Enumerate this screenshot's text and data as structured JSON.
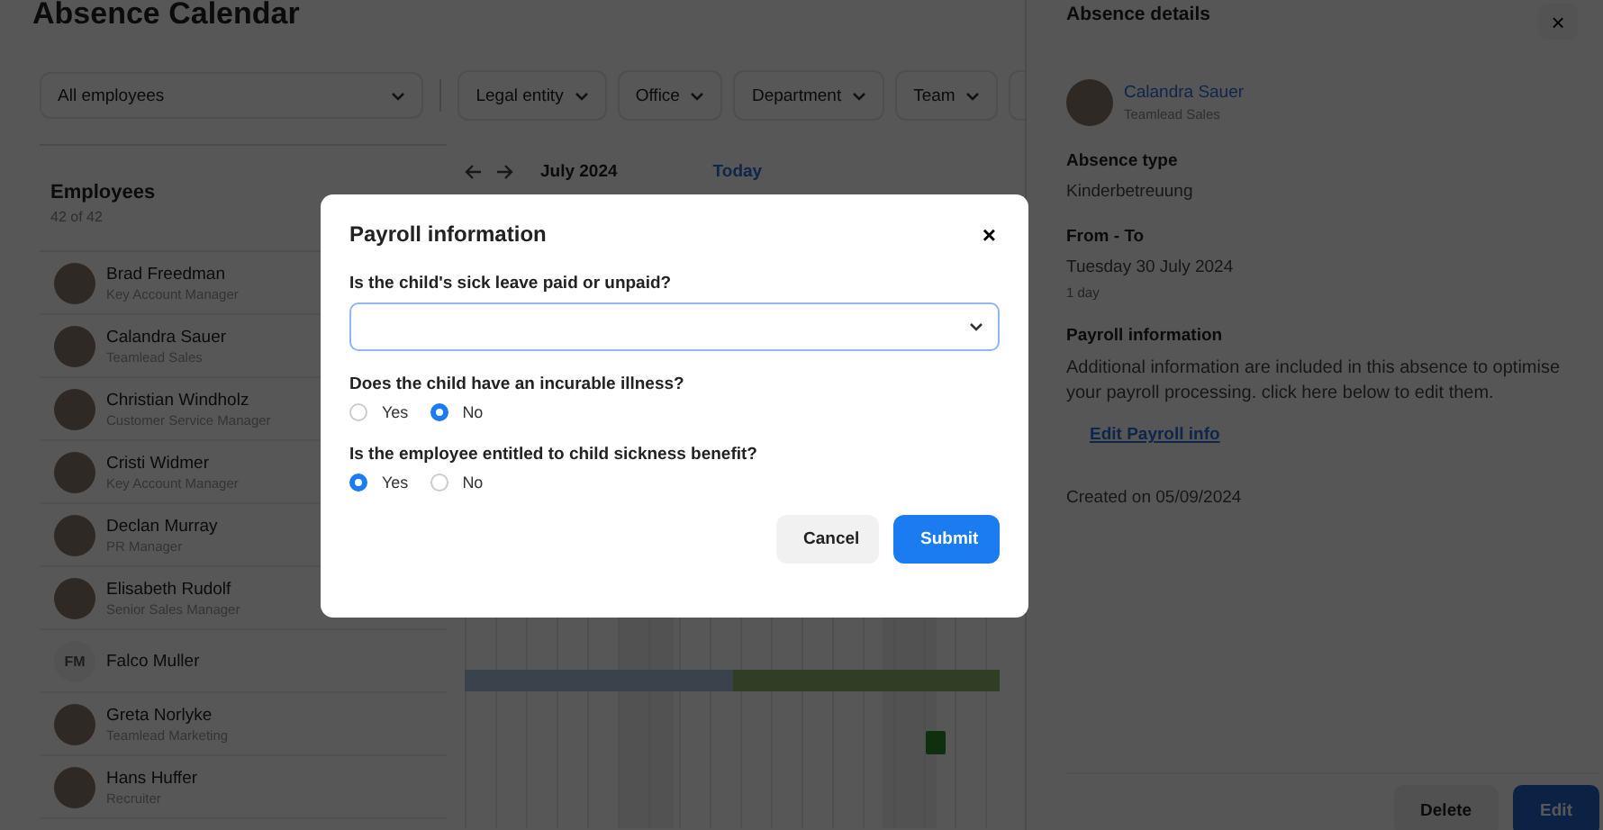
{
  "page_title": "Absence Calendar",
  "filters": {
    "employee_select": "All employees",
    "dropdowns": [
      "Legal entity",
      "Office",
      "Department",
      "Team"
    ]
  },
  "employees": {
    "title": "Employees",
    "count": "42 of 42",
    "items": [
      {
        "name": "Brad Freedman",
        "role": "Key Account Manager"
      },
      {
        "name": "Calandra Sauer",
        "role": "Teamlead Sales"
      },
      {
        "name": "Christian Windholz",
        "role": "Customer Service Manager"
      },
      {
        "name": "Cristi Widmer",
        "role": "Key Account Manager"
      },
      {
        "name": "Declan Murray",
        "role": "PR Manager"
      },
      {
        "name": "Elisabeth Rudolf",
        "role": "Senior Sales Manager"
      },
      {
        "name": "Falco Muller",
        "initials": "FM"
      },
      {
        "name": "Greta Norlyke",
        "role": "Teamlead Marketing"
      },
      {
        "name": "Hans Huffer",
        "role": "Recruiter"
      }
    ]
  },
  "calendar": {
    "month": "July 2024",
    "today": "Today"
  },
  "details": {
    "title": "Absence details",
    "close": "×",
    "person": {
      "name": "Calandra Sauer",
      "role": "Teamlead Sales"
    },
    "sections": [
      {
        "heading": "Absence type",
        "lines": [
          "Kinderbetreuung"
        ]
      },
      {
        "heading": "From - To",
        "lines": [
          "Tuesday 30 July 2024"
        ],
        "note": "1 day"
      },
      {
        "heading": "Payroll information",
        "text": "Additional information are included in this absence to optimise your payroll processing. click here below to edit them.",
        "link": "Edit Payroll info"
      }
    ],
    "created": "Created on 05/09/2024",
    "buttons": {
      "delete": "Delete",
      "edit": "Edit"
    }
  },
  "dialog": {
    "title": "Payroll information",
    "close": "×",
    "questions": [
      {
        "kind": "select",
        "label": "Is the child's sick leave paid or unpaid?"
      },
      {
        "kind": "radio",
        "label": "Does the child have an incurable illness?",
        "options": [
          {
            "label": "Yes",
            "selected": false
          },
          {
            "label": "No",
            "selected": true
          }
        ]
      },
      {
        "kind": "radio",
        "label": "Is the employee entitled to child sickness benefit?",
        "options": [
          {
            "label": "Yes",
            "selected": true
          },
          {
            "label": "No",
            "selected": false
          }
        ]
      }
    ],
    "cancel": "Cancel",
    "submit": "Submit"
  }
}
